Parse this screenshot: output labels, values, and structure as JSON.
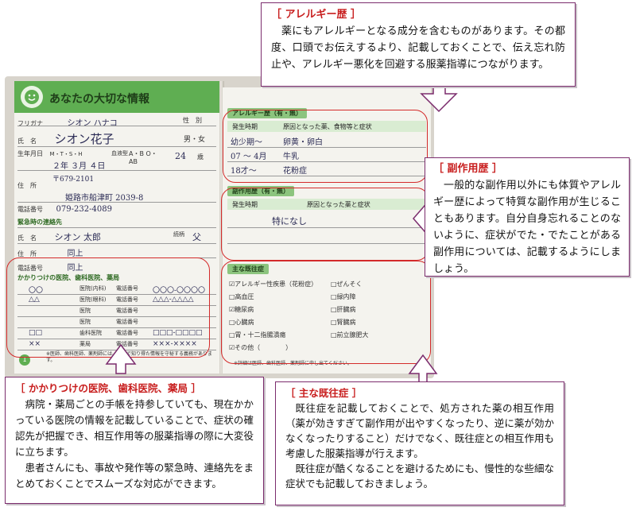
{
  "booklet": {
    "header_title": "あなたの大切な情報",
    "left": {
      "furigana_label": "フリガナ",
      "furigana_value": "シオン ハナコ",
      "sex_label": "性　別",
      "sex_value": "男・女",
      "name_label": "氏　名",
      "name_value": "シオン花子",
      "dob_label": "生年月日",
      "dob_era": "M・T・S・H",
      "dob_value": "２年 ３月 ４日",
      "blood_label": "血液型",
      "blood_value": "A・B O・AB",
      "age_value": "24",
      "age_unit": "歳",
      "address_label": "住　所",
      "address_zip": "〒679-2101",
      "address_value": "姫路市船津町 2039-8",
      "phone_label": "電話番号",
      "phone_value": "079-232-4089",
      "emergency_head": "緊急時の連絡先",
      "e_name_label": "氏　名",
      "e_name_value": "シオン 太郎",
      "relation_label": "続柄",
      "relation_value": "父",
      "e_address_label": "住　所",
      "e_address_value": "同上",
      "e_phone_label": "電話番号",
      "e_phone_value": "同上",
      "clinic_head": "かかりつけの医院、歯科医院、薬局",
      "clinic_rows": [
        {
          "name": "〇〇",
          "type": "医院(内科)",
          "tel_label": "電話番号",
          "tel": "〇〇〇-〇〇〇〇"
        },
        {
          "name": "△△",
          "type": "医院(眼科)",
          "tel_label": "電話番号",
          "tel": "△△△-△△△△"
        },
        {
          "name": "",
          "type": "医院",
          "tel_label": "電話番号",
          "tel": ""
        },
        {
          "name": "",
          "type": "医院",
          "tel_label": "電話番号",
          "tel": ""
        },
        {
          "name": "□□",
          "type": "歯科医院",
          "tel_label": "電話番号",
          "tel": "□□□-□□□□"
        },
        {
          "name": "××",
          "type": "薬局",
          "tel_label": "電話番号",
          "tel": "×××-××××"
        }
      ],
      "footnote": "※医師、歯科医師、薬剤師には、手帳で知り得た情報を守秘する義務があります。",
      "page_no": "1"
    },
    "right": {
      "allergy_head": "アレルギー歴",
      "allergy_choice": "（有・無）",
      "allergy_col1": "発生時期",
      "allergy_col2": "原因となった薬、食物等と症状",
      "allergy_rows": [
        {
          "when": "幼少期〜",
          "what": "卵黄・卵白"
        },
        {
          "when": "07 〜 4月",
          "what": "牛乳"
        },
        {
          "when": "18才〜",
          "what": "花粉症"
        }
      ],
      "side_head": "副作用歴",
      "side_choice": "（有・無）",
      "side_col1": "発生時期",
      "side_col2": "原因となった薬と症状",
      "side_entry": "特になし",
      "history_head": "主な既往症",
      "history_left": [
        "☑アレルギー性疾患（花粉症）",
        "□高血圧",
        "☑糖尿病",
        "□心臓病",
        "□胃・十二指腸潰瘍",
        "☑その他（　　　　）"
      ],
      "history_right": [
        "□ぜんそく",
        "□緑内障",
        "□肝臓病",
        "□腎臓病",
        "□前立腺肥大"
      ],
      "footnote": "※詳細は医師、歯科医師、薬剤師に申し出てください。",
      "page_no": "1"
    }
  },
  "callouts": {
    "allergy": {
      "title": "［ アレルギー歴 ］",
      "body": "薬にもアレルギーとなる成分を含むものがあります。その都度、口頭でお伝えするより、記載しておくことで、伝え忘れ防止や、アレルギー悪化を回避する服薬指導につながります。"
    },
    "side_effect": {
      "title": "［ 副作用歴 ］",
      "body": "一般的な副作用以外にも体質やアレルギー歴によって特質な副作用が生じることもあります。自分自身忘れることのないように、症状がでた・でたことがある副作用については、記載するようにしましょう。"
    },
    "clinic": {
      "title": "［ かかりつけの医院、歯科医院、薬局 ］",
      "body1": "病院・薬局ごとの手帳を持参していても、現在かかっている医院の情報を記載していることで、症状の確認先が把握でき、相互作用等の服薬指導の際に大変役に立ちます。",
      "body2": "患者さんにも、事故や発作等の緊急時、連絡先をまとめておくことでスムーズな対応ができます。"
    },
    "history": {
      "title": "［ 主な既往症 ］",
      "body1": "既往症を記載しておくことで、処方された薬の相互作用（薬が効きすぎて副作用が出やすくなったり、逆に薬が効かなくなったりすること）だけでなく、既往症との相互作用も考慮した服薬指導が行えます。",
      "body2": "既往症が酷くなることを避けるためにも、慢性的な些細な症状でも記載しておきましょう。"
    }
  },
  "colors": {
    "callout_border": "#7b2c6d",
    "callout_title": "#c81e1e",
    "highlight_oval": "#d42a2a",
    "header_green": "#5fae52"
  }
}
